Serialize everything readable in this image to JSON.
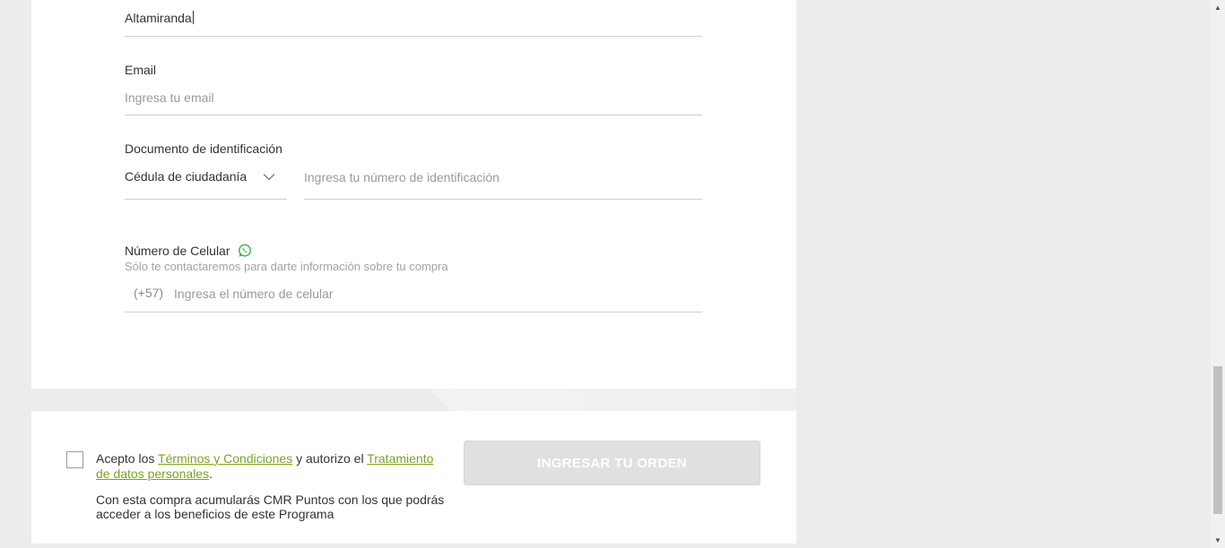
{
  "form": {
    "last_name_value": "Altamiranda",
    "email": {
      "label": "Email",
      "placeholder": "Ingresa tu email"
    },
    "document": {
      "label": "Documento de identificación",
      "type_selected": "Cédula de ciudadanía",
      "number_placeholder": "Ingresa tu número de identificación"
    },
    "phone": {
      "label": "Número de Celular",
      "helper": "Sólo te contactaremos para darte información sobre tu compra",
      "prefix": "(+57)",
      "placeholder": "Ingresa el número de celular"
    }
  },
  "footer": {
    "terms_before": "Acepto los ",
    "terms_link": "Términos y Condiciones",
    "terms_middle": " y autorizo el ",
    "privacy_link": "Tratamiento de datos personales",
    "terms_after": ".",
    "cmr_text": "Con esta compra acumularás CMR Puntos con los que podrás acceder a los beneficios de este Programa",
    "submit_label": "INGRESAR TU ORDEN"
  },
  "colors": {
    "link_green": "#7aa51b",
    "whatsapp_green": "#2db742",
    "button_disabled": "#e0e0e0"
  },
  "icons": {
    "phone_label_icon": "whatsapp-icon",
    "select_icon": "chevron-down-icon"
  }
}
